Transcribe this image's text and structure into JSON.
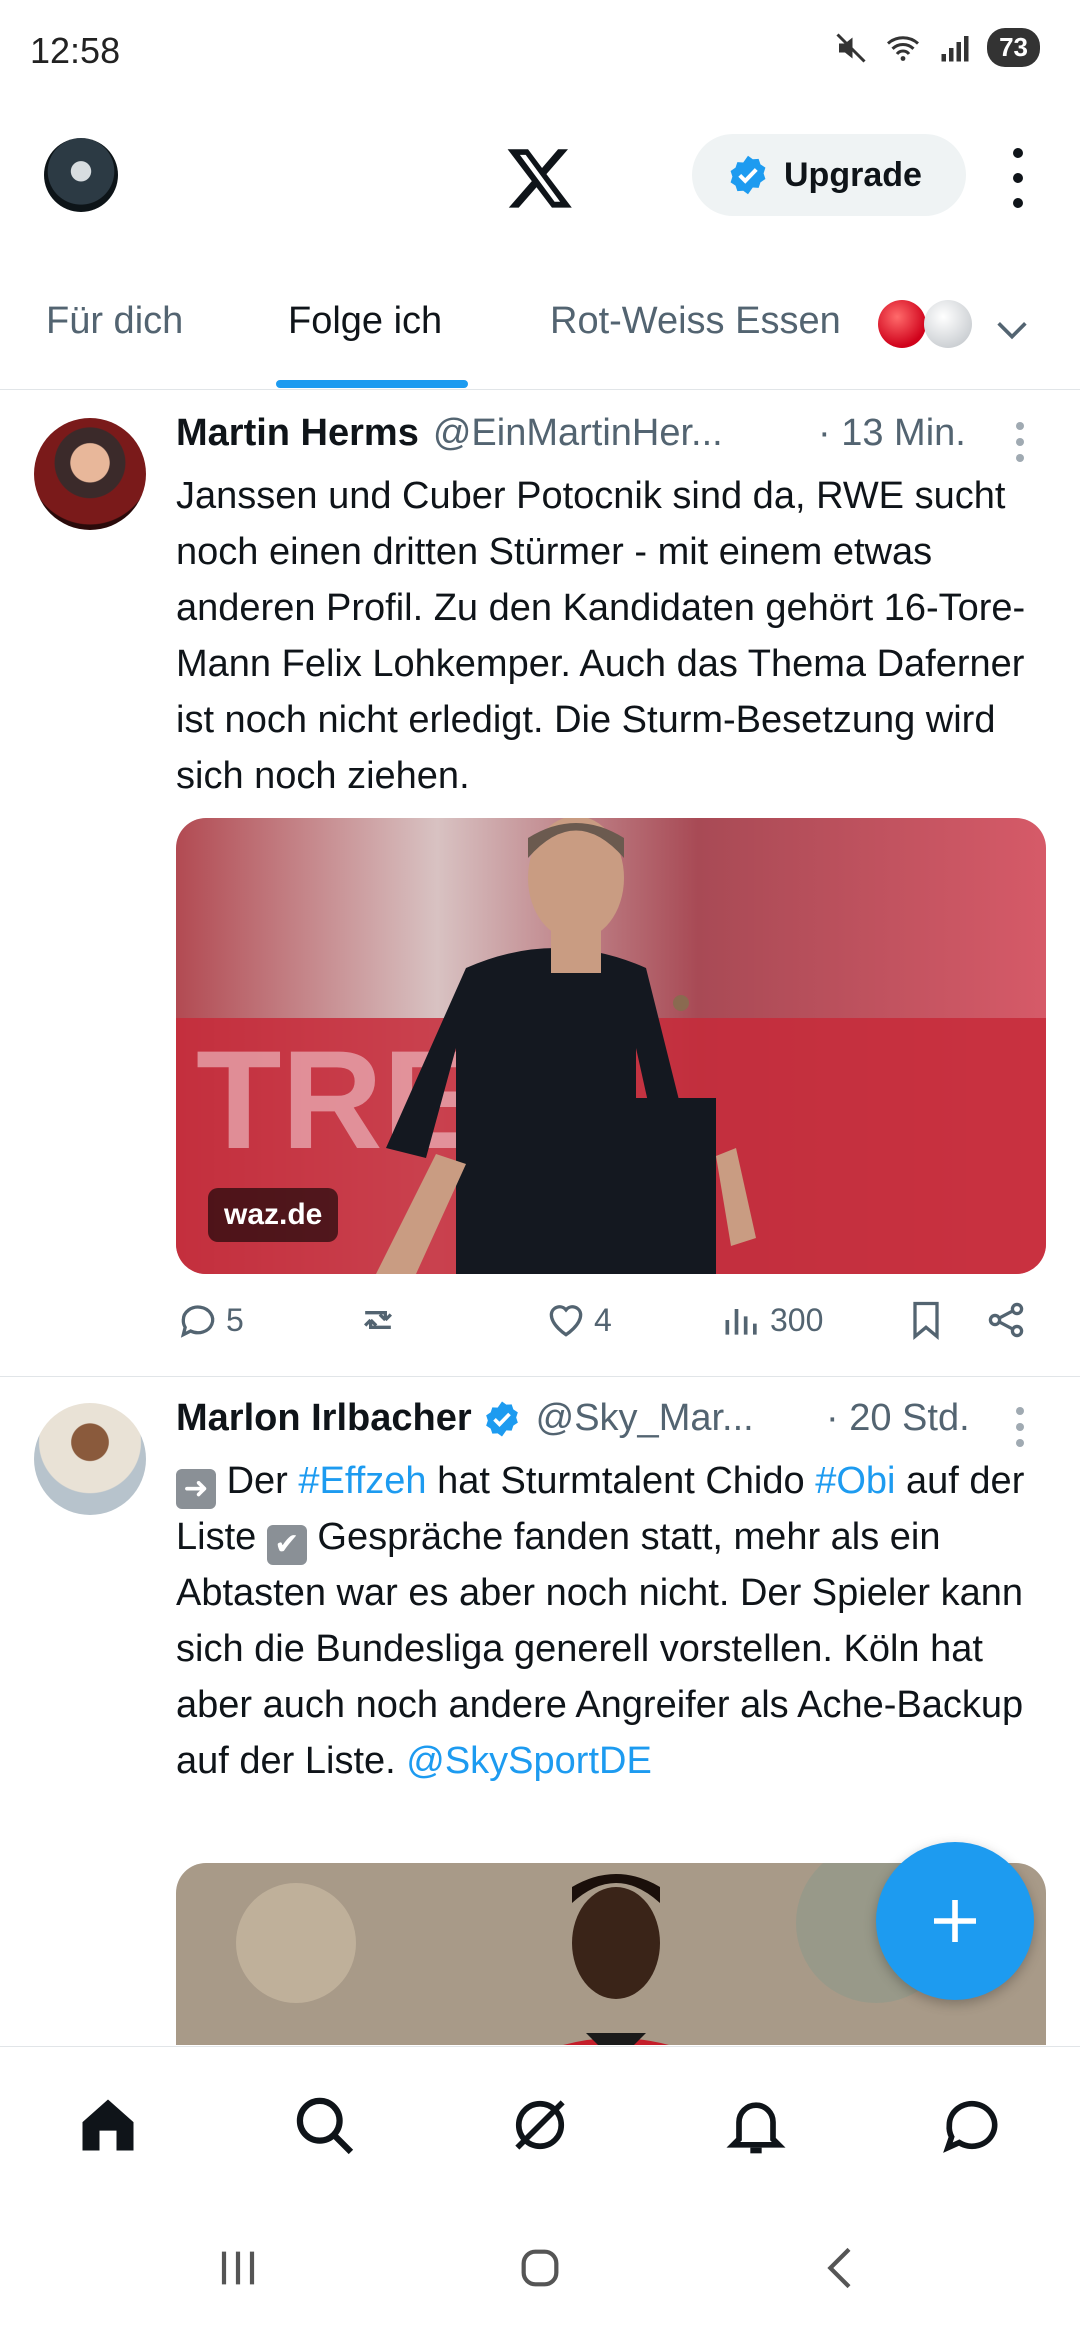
{
  "status_bar": {
    "time": "12:58",
    "battery": "73"
  },
  "top_bar": {
    "upgrade_label": "Upgrade"
  },
  "tabs": [
    {
      "label": "Für dich"
    },
    {
      "label": "Folge ich"
    },
    {
      "label": "Rot-Weiss Essen"
    }
  ],
  "posts": [
    {
      "name": "Martin Herms",
      "handle": "@EinMartinHer...",
      "time": "· 13 Min.",
      "text": "Janssen und Cuber Potocnik sind da, RWE sucht noch einen dritten Stürmer - mit einem etwas anderen Profil. Zu den Kandidaten gehört 16-Tore-Mann Felix Lohkemper. Auch das Thema Daferner ist noch nicht erledigt. Die Sturm-Besetzung wird sich noch ziehen.",
      "media_source": "waz.de",
      "replies": "5",
      "reposts": "",
      "likes": "4",
      "views": "300"
    },
    {
      "name": "Marlon Irlbacher",
      "handle": "@Sky_Mar...",
      "time": "· 20 Std.",
      "text_parts": {
        "p1": "Der ",
        "tag1": "#Effzeh",
        "p2": " hat Sturmtalent Chido ",
        "tag2": "#Obi",
        "p3": " auf der Liste ",
        "p4": " Gespräche fanden statt, mehr als ein Abtasten war es aber noch nicht. Der Spieler kann sich die Bundesliga generell vorstellen. Köln hat aber auch noch andere Angreifer als Ache-Backup auf der Liste. ",
        "mention": "@SkySportDE"
      }
    }
  ],
  "colors": {
    "accent": "#1d9bf0",
    "text": "#0f1419",
    "secondary": "#536471"
  }
}
